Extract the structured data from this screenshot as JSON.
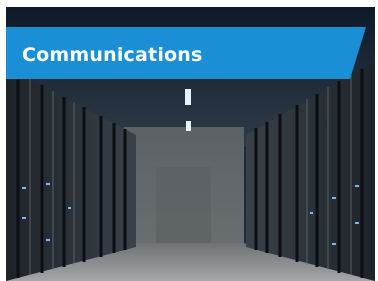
{
  "banner": {
    "title": "Communications",
    "color": "#1b8fd6",
    "text_color": "#ffffff"
  },
  "image": {
    "subject": "server-room-photo"
  }
}
